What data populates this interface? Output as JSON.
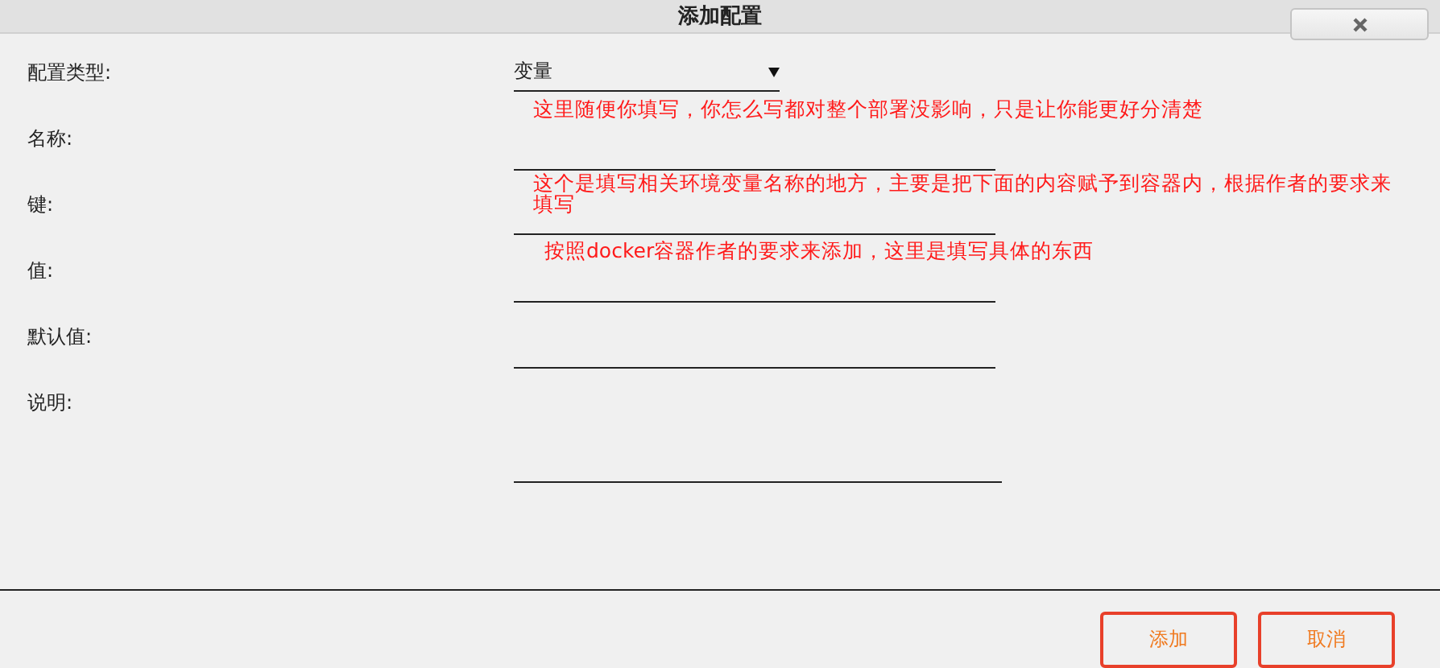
{
  "window": {
    "title": "添加配置"
  },
  "fields": [
    {
      "kind": "select",
      "label": "配置类型:",
      "value": "变量"
    },
    {
      "kind": "text",
      "label": "名称:",
      "note": "这里随便你填写，你怎么写都对整个部署没影响，只是让你能更好分清楚"
    },
    {
      "kind": "text",
      "label": "键:",
      "note": "这个是填写相关环境变量名称的地方，主要是把下面的内容赋予到容器内，根据作者的要求来填写"
    },
    {
      "kind": "text",
      "label": "值:",
      "note": "按照docker容器作者的要求来添加，这里是填写具体的东西"
    },
    {
      "kind": "text",
      "label": "默认值:"
    },
    {
      "kind": "textarea",
      "label": "说明:"
    }
  ],
  "buttons": [
    "添加",
    "取消"
  ]
}
